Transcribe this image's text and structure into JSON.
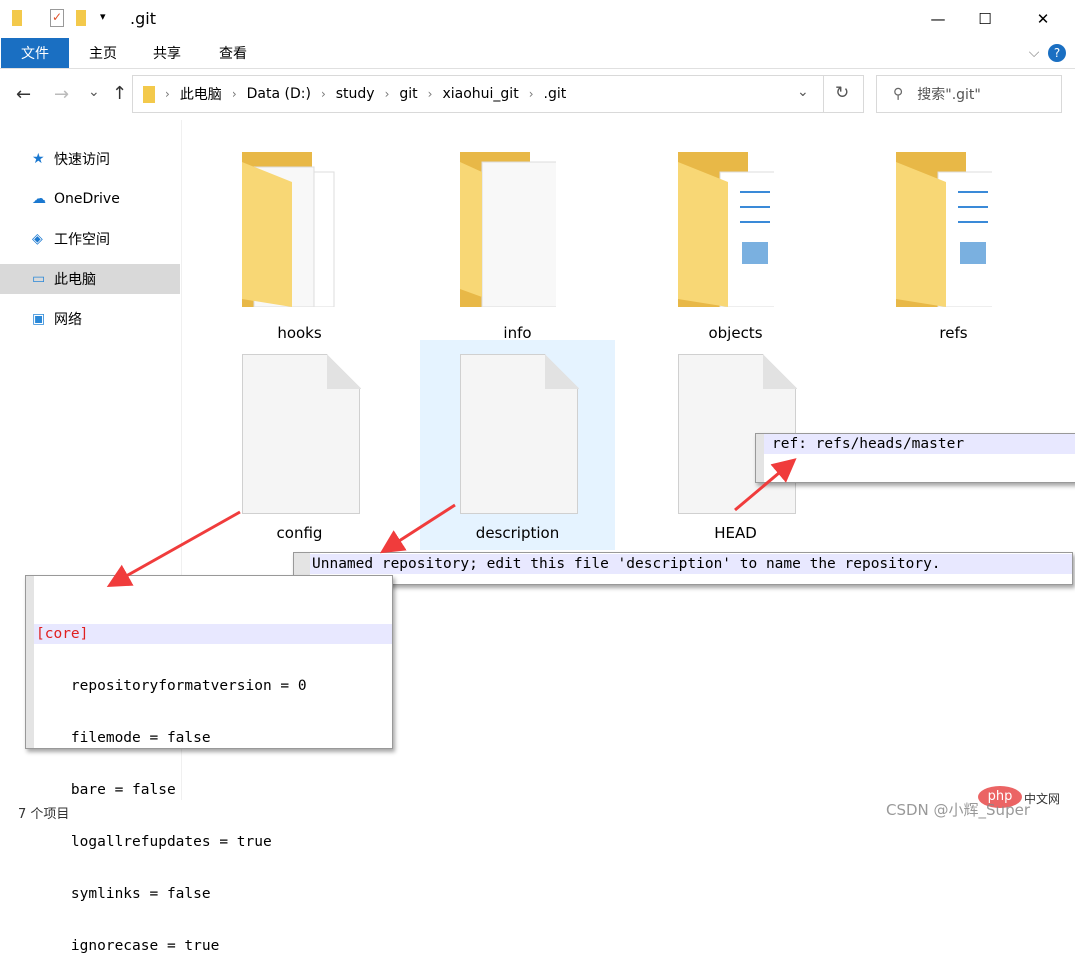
{
  "window": {
    "title": ".git",
    "minimize": "—",
    "maximize": "☐",
    "close": "✕"
  },
  "ribbon": {
    "tabs": [
      "文件",
      "主页",
      "共享",
      "查看"
    ],
    "help": "?",
    "expand": "⌵"
  },
  "nav": {
    "back": "←",
    "forward": "→",
    "recent": "⌄",
    "up": "↑",
    "refresh": "↻",
    "dropdown": "⌄"
  },
  "breadcrumb": [
    "此电脑",
    "Data (D:)",
    "study",
    "git",
    "xiaohui_git",
    ".git"
  ],
  "search": {
    "placeholder": "搜索\".git\""
  },
  "sidebar": {
    "items": [
      {
        "label": "快速访问",
        "icon": "star-icon"
      },
      {
        "label": "OneDrive",
        "icon": "cloud-icon"
      },
      {
        "label": "工作空间",
        "icon": "workspace-icon"
      },
      {
        "label": "此电脑",
        "icon": "computer-icon",
        "selected": true
      },
      {
        "label": "网络",
        "icon": "network-icon"
      }
    ]
  },
  "items": [
    {
      "name": "hooks",
      "type": "folder"
    },
    {
      "name": "info",
      "type": "folder"
    },
    {
      "name": "objects",
      "type": "folder"
    },
    {
      "name": "refs",
      "type": "folder"
    },
    {
      "name": "config",
      "type": "file"
    },
    {
      "name": "description",
      "type": "file",
      "selected": true
    },
    {
      "name": "HEAD",
      "type": "file"
    }
  ],
  "status": "7 个项目",
  "popups": {
    "head": [
      "ref: refs/heads/master"
    ],
    "description": [
      "Unnamed repository; edit this file 'description' to name the repository."
    ],
    "config": [
      "[core]",
      "    repositoryformatversion = 0",
      "    filemode = false",
      "    bare = false",
      "    logallrefupdates = true",
      "    symlinks = false",
      "    ignorecase = true"
    ]
  },
  "watermark": {
    "csdn": "CSDN @小辉_Super",
    "php": "php中文网"
  },
  "colors": {
    "accent": "#1a6fc2",
    "selection": "#e5f3ff",
    "arrow": "#f03c3c",
    "folder": "#f8d775"
  }
}
